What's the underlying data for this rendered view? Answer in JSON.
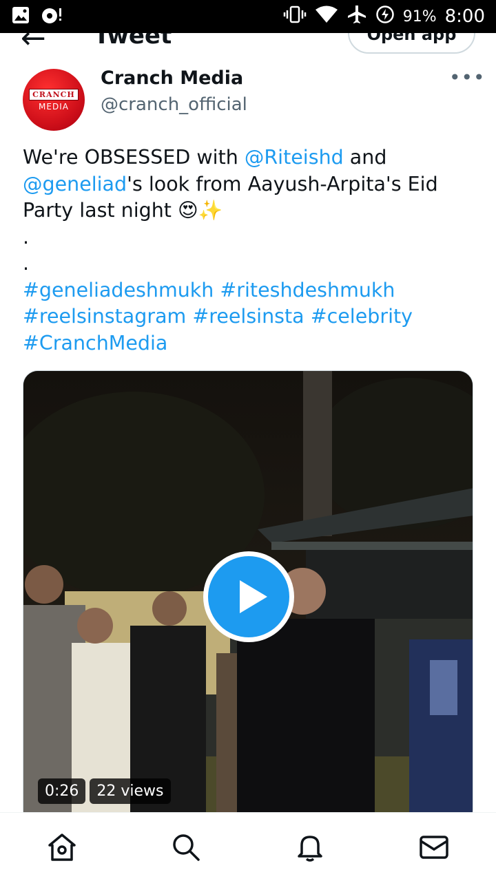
{
  "status_bar": {
    "battery_percent": "91%",
    "time": "8:00"
  },
  "header": {
    "title": "Tweet",
    "open_app_label": "Open app"
  },
  "author": {
    "name": "Cranch Media",
    "handle": "@cranch_official",
    "avatar_text_line1": "CRANCH",
    "avatar_text_line2": "MEDIA"
  },
  "tweet": {
    "line1_pre": "We're OBSESSED with ",
    "line1_mention": "@Riteishd",
    "line1_post": " and",
    "line2_mention": "@geneliad",
    "line2_post": "'s look from Aayush-Arpita's Eid",
    "line3_text": "Party last night ",
    "line3_emoji": "😍✨",
    "dot1": ".",
    "dot2": ".",
    "hashtags": [
      "#geneliadeshmukh",
      "#riteshdeshmukh",
      "#reelsinstagram",
      "#reelsinsta",
      "#celebrity",
      "#CranchMedia"
    ]
  },
  "video": {
    "duration": "0:26",
    "views": "22 views"
  },
  "nav": {
    "icons": [
      "home-icon",
      "search-icon",
      "notifications-bell-icon",
      "messages-envelope-icon"
    ]
  },
  "colors": {
    "accent": "#1d9bf0",
    "text": "#0f1419",
    "secondary": "#536471"
  }
}
